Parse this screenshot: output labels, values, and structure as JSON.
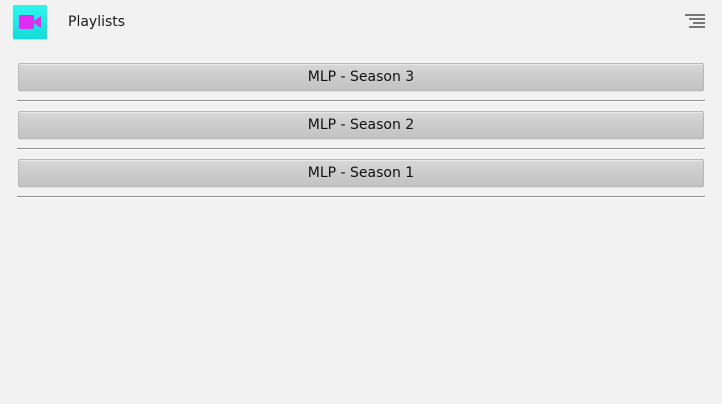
{
  "app": {
    "title": "Playlists",
    "icon": "video-camera-icon",
    "accent_color": "#2ff5f0",
    "icon_color": "#e02cf0"
  },
  "menu": {
    "icon": "overflow-menu-icon"
  },
  "playlists": [
    {
      "label": "MLP - Season 3"
    },
    {
      "label": "MLP - Season 2"
    },
    {
      "label": "MLP - Season 1"
    }
  ]
}
